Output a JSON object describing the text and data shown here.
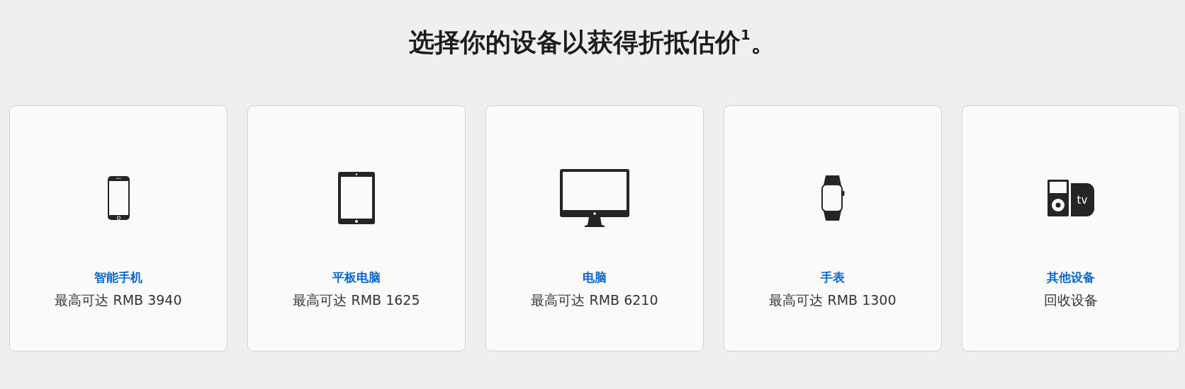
{
  "heading": "选择你的设备以获得折抵估价$^{1}$。",
  "devices": [
    {
      "kind": "phone",
      "name": "智能手机",
      "note": "最高可达 RMB 3940"
    },
    {
      "kind": "tablet",
      "name": "平板电脑",
      "note": "最高可达 RMB 1625"
    },
    {
      "kind": "computer",
      "name": "电脑",
      "note": "最高可达 RMB 6210"
    },
    {
      "kind": "watch",
      "name": "手表",
      "note": "最高可达 RMB 1300"
    },
    {
      "kind": "other",
      "name": "其他设备",
      "note": "回收设备",
      "icon_label": "tv"
    }
  ]
}
